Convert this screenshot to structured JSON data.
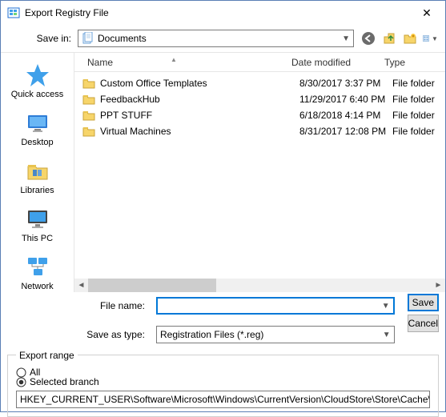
{
  "title": "Export Registry File",
  "save_in_label": "Save in:",
  "save_in_value": "Documents",
  "places": [
    {
      "label": "Quick access"
    },
    {
      "label": "Desktop"
    },
    {
      "label": "Libraries"
    },
    {
      "label": "This PC"
    },
    {
      "label": "Network"
    }
  ],
  "columns": {
    "name": "Name",
    "date": "Date modified",
    "type": "Type"
  },
  "files": [
    {
      "name": "Custom Office Templates",
      "date": "8/30/2017 3:37 PM",
      "type": "File folder"
    },
    {
      "name": "FeedbackHub",
      "date": "11/29/2017 6:40 PM",
      "type": "File folder"
    },
    {
      "name": "PPT STUFF",
      "date": "6/18/2018 4:14 PM",
      "type": "File folder"
    },
    {
      "name": "Virtual Machines",
      "date": "8/31/2017 12:08 PM",
      "type": "File folder"
    }
  ],
  "file_name_label": "File name:",
  "file_name_value": "",
  "save_type_label": "Save as type:",
  "save_type_value": "Registration Files (*.reg)",
  "btn_save": "Save",
  "btn_cancel": "Cancel",
  "export_range": {
    "legend": "Export range",
    "all": "All",
    "selected": "Selected branch",
    "path": "HKEY_CURRENT_USER\\Software\\Microsoft\\Windows\\CurrentVersion\\CloudStore\\Store\\Cache\\Def"
  }
}
